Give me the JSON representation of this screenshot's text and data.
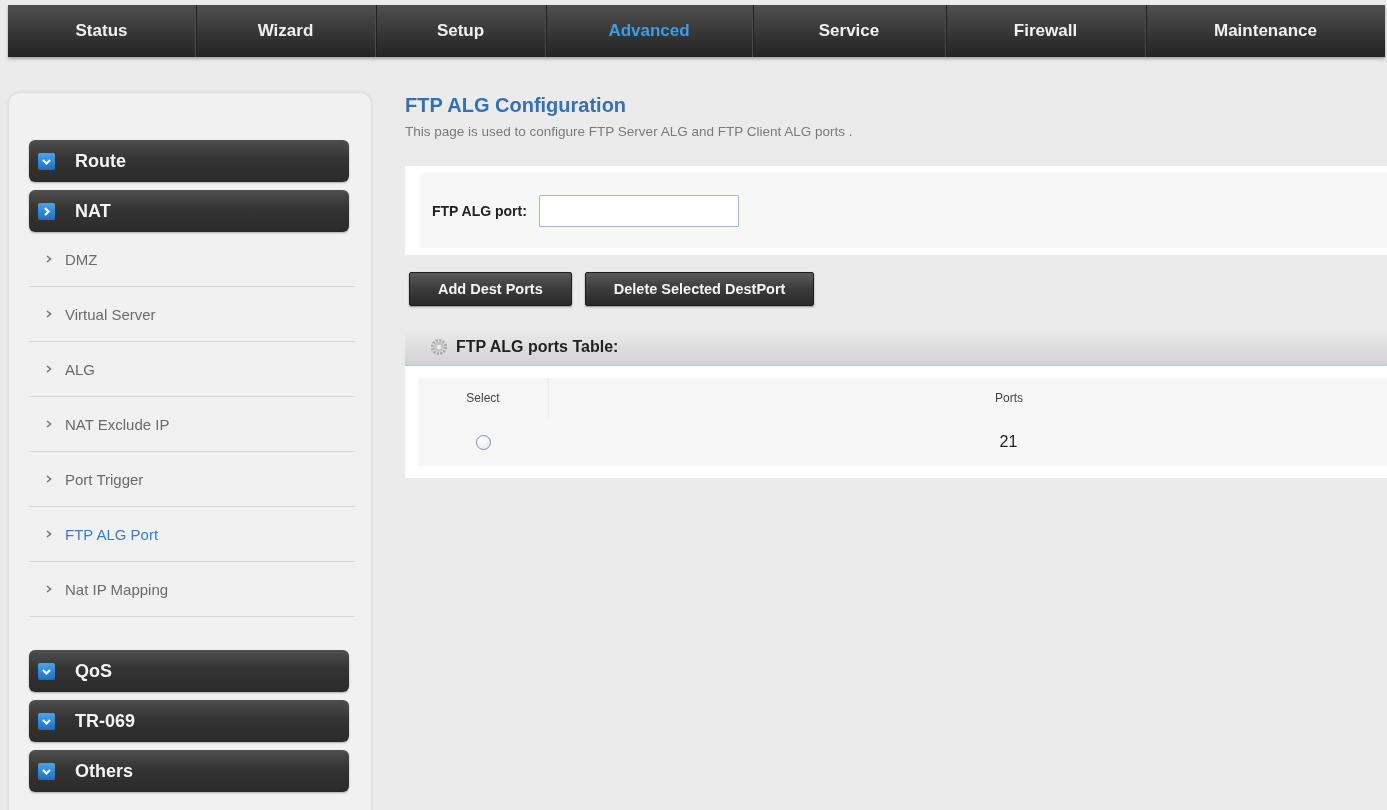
{
  "nav": {
    "tabs": [
      {
        "label": "Status",
        "selected": false
      },
      {
        "label": "Wizard",
        "selected": false
      },
      {
        "label": "Setup",
        "selected": false
      },
      {
        "label": "Advanced",
        "selected": true
      },
      {
        "label": "Service",
        "selected": false
      },
      {
        "label": "Firewall",
        "selected": false
      },
      {
        "label": "Maintenance",
        "selected": false
      }
    ]
  },
  "sidebar": {
    "groups": [
      {
        "label": "Route",
        "expanded": false
      },
      {
        "label": "NAT",
        "expanded": true,
        "items": [
          {
            "label": "DMZ",
            "selected": false
          },
          {
            "label": "Virtual Server",
            "selected": false
          },
          {
            "label": "ALG",
            "selected": false
          },
          {
            "label": "NAT Exclude IP",
            "selected": false
          },
          {
            "label": "Port Trigger",
            "selected": false
          },
          {
            "label": "FTP ALG Port",
            "selected": true
          },
          {
            "label": "Nat IP Mapping",
            "selected": false
          }
        ]
      },
      {
        "label": "QoS",
        "expanded": false
      },
      {
        "label": "TR-069",
        "expanded": false
      },
      {
        "label": "Others",
        "expanded": false
      }
    ]
  },
  "page": {
    "title": "FTP ALG Configuration",
    "description": "This page is used to configure FTP Server ALG and FTP Client ALG ports ."
  },
  "form": {
    "fields": [
      {
        "label": "FTP ALG port:"
      }
    ]
  },
  "buttons": [
    "Add Dest Ports",
    "Delete Selected DestPort"
  ],
  "table": {
    "title": "FTP ALG ports Table:",
    "columns": [
      "Select",
      "Ports"
    ],
    "rows": [
      {
        "selected": false,
        "port": "21"
      }
    ]
  }
}
